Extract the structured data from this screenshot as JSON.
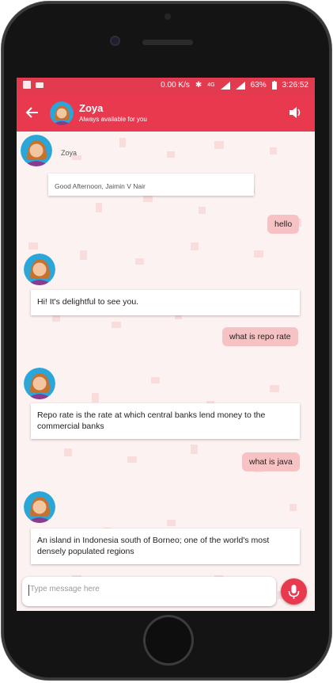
{
  "status_bar": {
    "net_speed": "0.00 K/s",
    "battery_percent": "63%",
    "time": "3:26:52",
    "signal": "4G"
  },
  "header": {
    "title": "Zoya",
    "subtitle": "Always available for you"
  },
  "chat": {
    "bot_name": "Zoya",
    "greeting": "Good Afternoon, Jaimin V Nair",
    "messages": [
      {
        "from": "user",
        "text": "hello"
      },
      {
        "from": "bot",
        "text": "Hi! It's delightful to see you."
      },
      {
        "from": "user",
        "text": "what is repo rate"
      },
      {
        "from": "bot",
        "text": "Repo rate is the rate at which central banks lend money to the commercial banks"
      },
      {
        "from": "user",
        "text": "what is java"
      },
      {
        "from": "bot",
        "text": "An island in Indonesia south of Borneo; one of the world's most densely populated regions"
      }
    ]
  },
  "composer": {
    "placeholder": "Type message here"
  },
  "colors": {
    "accent": "#e8394f",
    "user_bubble": "#f7c2c3",
    "background": "#fdf2f2"
  }
}
